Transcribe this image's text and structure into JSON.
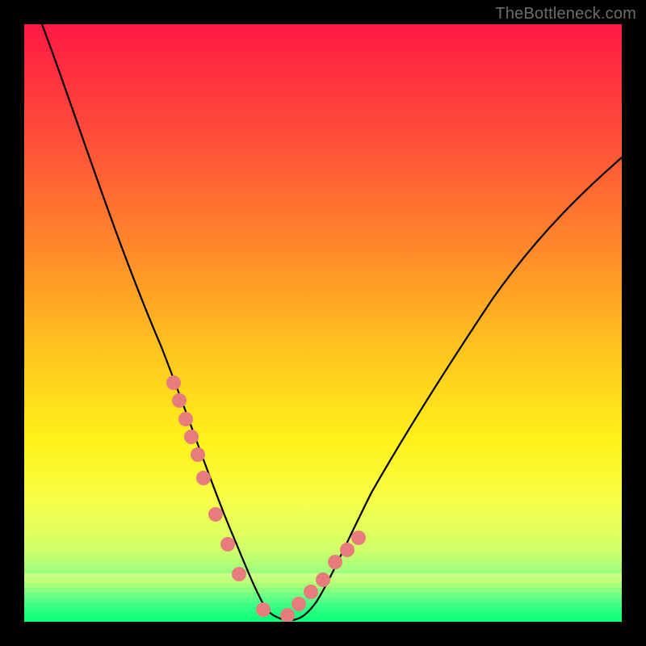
{
  "watermark": "TheBottleneck.com",
  "chart_data": {
    "type": "line",
    "title": "",
    "xlabel": "",
    "ylabel": "",
    "xlim": [
      0,
      100
    ],
    "ylim": [
      0,
      100
    ],
    "grid": false,
    "legend": false,
    "annotations": [],
    "series": [
      {
        "name": "bottleneck-curve",
        "x": [
          3,
          8,
          13,
          18,
          23,
          26,
          28,
          30,
          32,
          34,
          36,
          38,
          40,
          42,
          44,
          46,
          50,
          55,
          60,
          65,
          72,
          80,
          90,
          100
        ],
        "values": [
          100,
          88,
          74,
          60,
          46,
          38,
          31,
          24,
          18,
          13,
          8,
          5,
          2,
          1,
          1,
          3,
          7,
          13,
          21,
          30,
          42,
          55,
          68,
          78
        ]
      }
    ],
    "data_markers": {
      "name": "highlighted-range",
      "color": "#e77c7c",
      "x": [
        25,
        26,
        27,
        28,
        29,
        30,
        32,
        34,
        36,
        40,
        44,
        46,
        48,
        50,
        52,
        54,
        56
      ],
      "values": [
        40,
        37,
        34,
        31,
        28,
        24,
        18,
        13,
        8,
        2,
        1,
        3,
        5,
        7,
        10,
        12,
        14
      ]
    },
    "background_gradient": {
      "top": "#ff1a44",
      "middle": "#fff21a",
      "bottom": "#1aff7a"
    }
  }
}
